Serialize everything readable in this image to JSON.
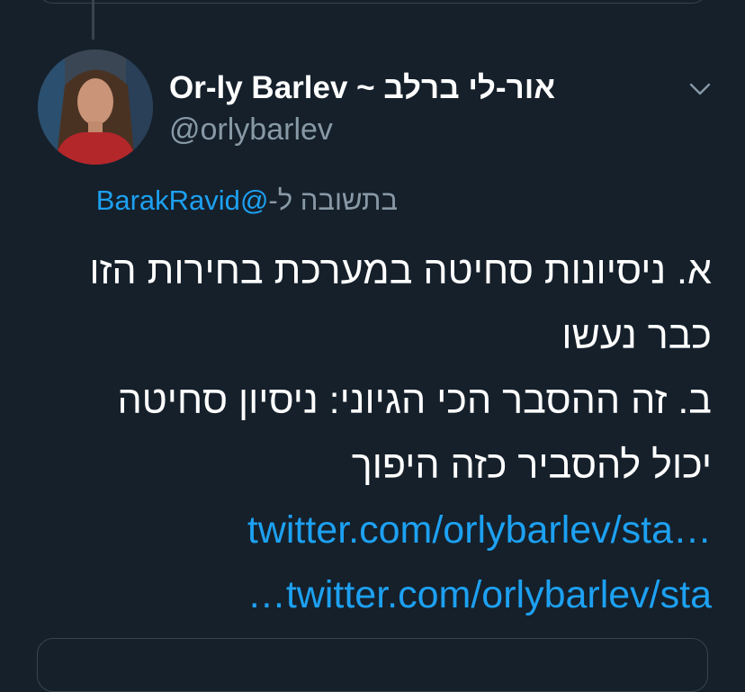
{
  "author": {
    "display_name": "Or-ly Barlev ~ אור-לי ברלב",
    "handle": "@orlybarlev",
    "avatar_icon": "profile-photo-icon"
  },
  "reply": {
    "prefix": "בתשובה ל-",
    "mention": "@BarakRavid"
  },
  "tweet": {
    "lines": [
      "א. ניסיונות סחיטה במערכת בחירות הזו",
      "כבר נעשו",
      "ב. זה ההסבר הכי הגיוני: ניסיון סחיטה",
      "יכול להסביר כזה היפוך"
    ],
    "links": [
      "twitter.com/orlybarlev/sta…",
      "…twitter.com/orlybarlev/sta"
    ]
  },
  "icons": {
    "menu": "chevron-down-icon"
  },
  "colors": {
    "background": "#15202b",
    "text": "#ffffff",
    "secondary_text": "#8899a6",
    "link": "#1da1f2",
    "border": "#38444d"
  }
}
